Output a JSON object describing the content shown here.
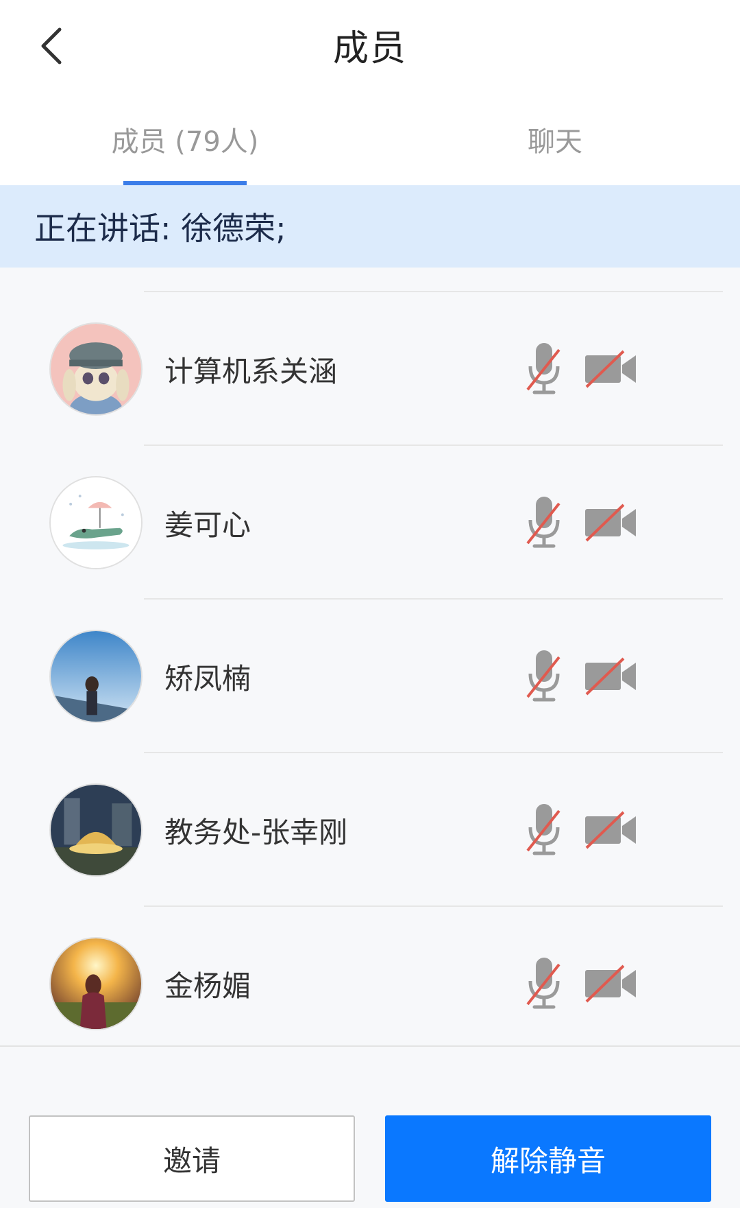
{
  "header": {
    "title": "成员"
  },
  "tabs": [
    {
      "label": "成员 (79人)",
      "active": true
    },
    {
      "label": "聊天",
      "active": false
    }
  ],
  "speaking": {
    "text": "正在讲话: 徐德荣;"
  },
  "members": [
    {
      "name": "计算机系关涵",
      "mic": "muted",
      "camera": "off"
    },
    {
      "name": "姜可心",
      "mic": "muted",
      "camera": "off"
    },
    {
      "name": "矫凤楠",
      "mic": "muted",
      "camera": "off"
    },
    {
      "name": "教务处-张幸刚",
      "mic": "muted",
      "camera": "off"
    },
    {
      "name": "金杨媚",
      "mic": "muted",
      "camera": "off"
    }
  ],
  "footer": {
    "invite_label": "邀请",
    "unmute_label": "解除静音"
  },
  "colors": {
    "accent": "#0a78ff",
    "tab_indicator": "#3b7de9",
    "speaking_bg": "#dcebfc",
    "muted_slash": "#e05a4f"
  }
}
